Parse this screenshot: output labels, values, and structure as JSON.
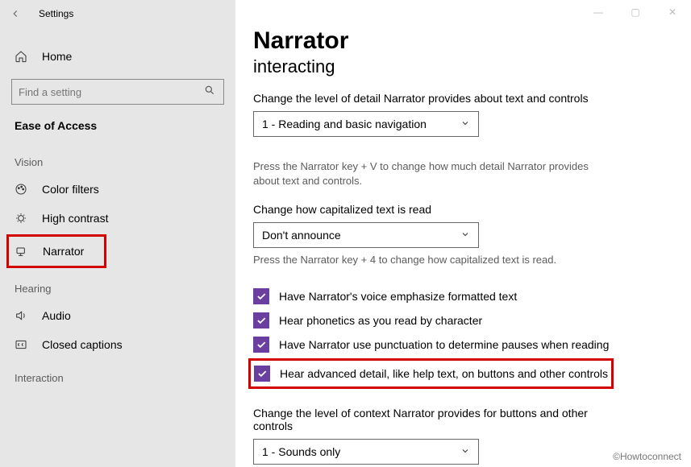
{
  "app_title": "Settings",
  "home_label": "Home",
  "search_placeholder": "Find a setting",
  "section_header": "Ease of Access",
  "groups": {
    "vision": "Vision",
    "hearing": "Hearing",
    "interaction": "Interaction"
  },
  "nav": {
    "color_filters": "Color filters",
    "high_contrast": "High contrast",
    "narrator": "Narrator",
    "audio": "Audio",
    "closed_captions": "Closed captions"
  },
  "page": {
    "title": "Narrator",
    "subtitle": "interacting",
    "detail_label": "Change the level of detail Narrator provides about text and controls",
    "detail_value": "1 - Reading and basic navigation",
    "detail_help": "Press the Narrator key + V to change how much detail Narrator provides about text and controls.",
    "caps_label": "Change how capitalized text is read",
    "caps_value": "Don't announce",
    "caps_help": "Press the Narrator key + 4 to change how capitalized text is read.",
    "cb1": "Have Narrator's voice emphasize formatted text",
    "cb2": "Hear phonetics as you read by character",
    "cb3": "Have Narrator use punctuation to determine pauses when reading",
    "cb4": "Hear advanced detail, like help text, on buttons and other controls",
    "context_label": "Change the level of context Narrator provides for buttons and other controls",
    "context_value": "1 - Sounds only"
  },
  "watermark": "©Howtoconnect"
}
